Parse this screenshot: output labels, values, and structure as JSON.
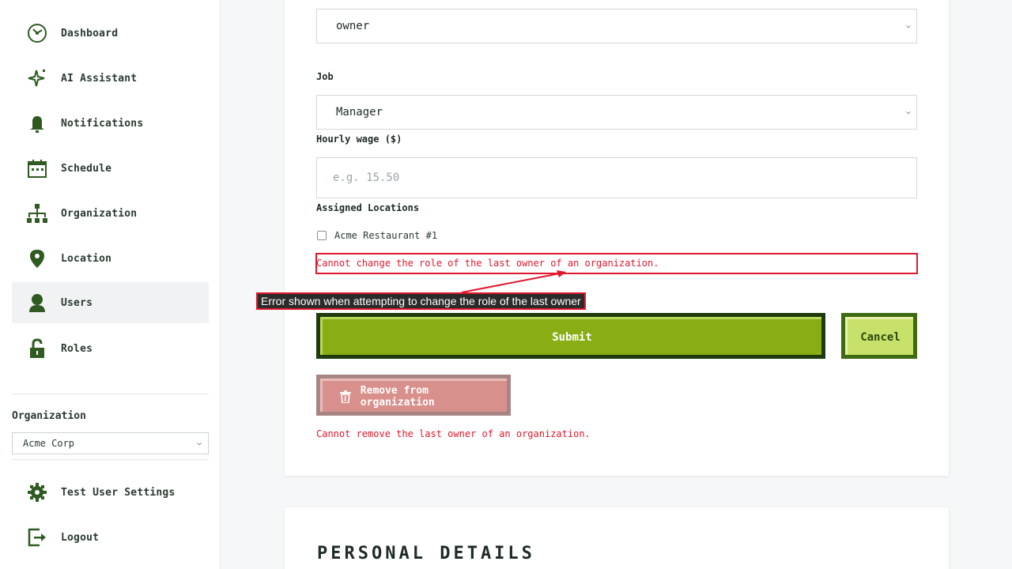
{
  "sidebar": {
    "items": [
      {
        "label": "Dashboard",
        "icon": "dashboard-icon"
      },
      {
        "label": "AI Assistant",
        "icon": "sparkle-icon"
      },
      {
        "label": "Notifications",
        "icon": "bell-icon"
      },
      {
        "label": "Schedule",
        "icon": "calendar-icon"
      },
      {
        "label": "Organization",
        "icon": "org-chart-icon"
      },
      {
        "label": "Location",
        "icon": "location-pin-icon"
      },
      {
        "label": "Users",
        "icon": "user-icon",
        "active": true
      },
      {
        "label": "Roles",
        "icon": "unlock-icon"
      }
    ],
    "organization_label": "Organization",
    "organization_value": "Acme Corp",
    "settings_label": "Test User Settings",
    "logout_label": "Logout"
  },
  "form": {
    "role_value": "owner",
    "job_label": "Job",
    "job_value": "Manager",
    "wage_label": "Hourly wage ($)",
    "wage_placeholder": "e.g. 15.50",
    "locations_label": "Assigned Locations",
    "location_option": "Acme Restaurant #1",
    "role_error": "Cannot change the role of the last owner of an organization.",
    "submit_label": "Submit",
    "cancel_label": "Cancel",
    "remove_label": "Remove from organization",
    "remove_error": "Cannot remove the last owner of an organization."
  },
  "annotation": {
    "text": "Error shown when attempting to change the role of the last owner"
  },
  "personal_details_heading": "PERSONAL DETAILS",
  "colors": {
    "accent_green": "#89ad14",
    "dark_green": "#1f3a0c",
    "error_red": "#e0182c",
    "remove_red": "#d8908c",
    "icon_green": "#2f5a22"
  }
}
